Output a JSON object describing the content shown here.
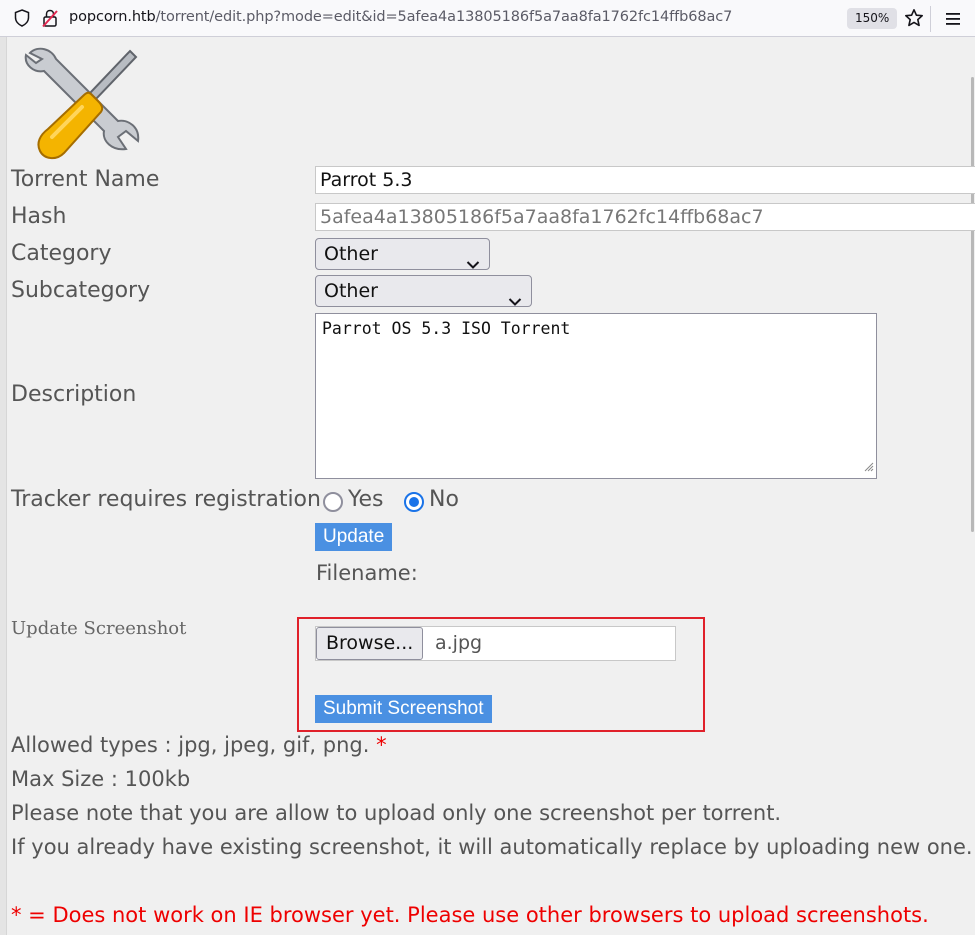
{
  "browser": {
    "url_host": "popcorn.htb",
    "url_path": "/torrent/edit.php?mode=edit&id=5afea4a13805186f5a7aa8fa1762fc14ffb68ac7",
    "zoom": "150%"
  },
  "form": {
    "torrent_name_label": "Torrent Name",
    "torrent_name_value": "Parrot 5.3",
    "hash_label": "Hash",
    "hash_value": "5afea4a13805186f5a7aa8fa1762fc14ffb68ac7",
    "category_label": "Category",
    "category_value": "Other",
    "subcategory_label": "Subcategory",
    "subcategory_value": "Other",
    "description_label": "Description",
    "description_value": "Parrot OS 5.3 ISO Torrent",
    "tracker_label": "Tracker requires registration",
    "radio_yes": "Yes",
    "radio_no": "No",
    "selected_radio": "No",
    "update_button": "Update",
    "filename_label": "Filename:"
  },
  "screenshot": {
    "label": "Update Screenshot",
    "browse_button": "Browse...",
    "file_name": "a.jpg",
    "submit_button": "Submit Screenshot"
  },
  "notes": {
    "allowed_types": "Allowed types : jpg, jpeg, gif, png.",
    "asterisk": "*",
    "max_size": "Max Size : 100kb",
    "one_screenshot": "Please note that you are allow to upload only one screenshot per torrent.",
    "replace": "If you already have existing screenshot, it will automatically replace by uploading new one.",
    "ie_warning": "* = Does not work on IE browser yet. Please use other browsers to upload screenshots."
  },
  "colors": {
    "accent_blue": "#4a90e2",
    "highlight_red": "#e0202a",
    "warning_red": "#ee0000"
  }
}
